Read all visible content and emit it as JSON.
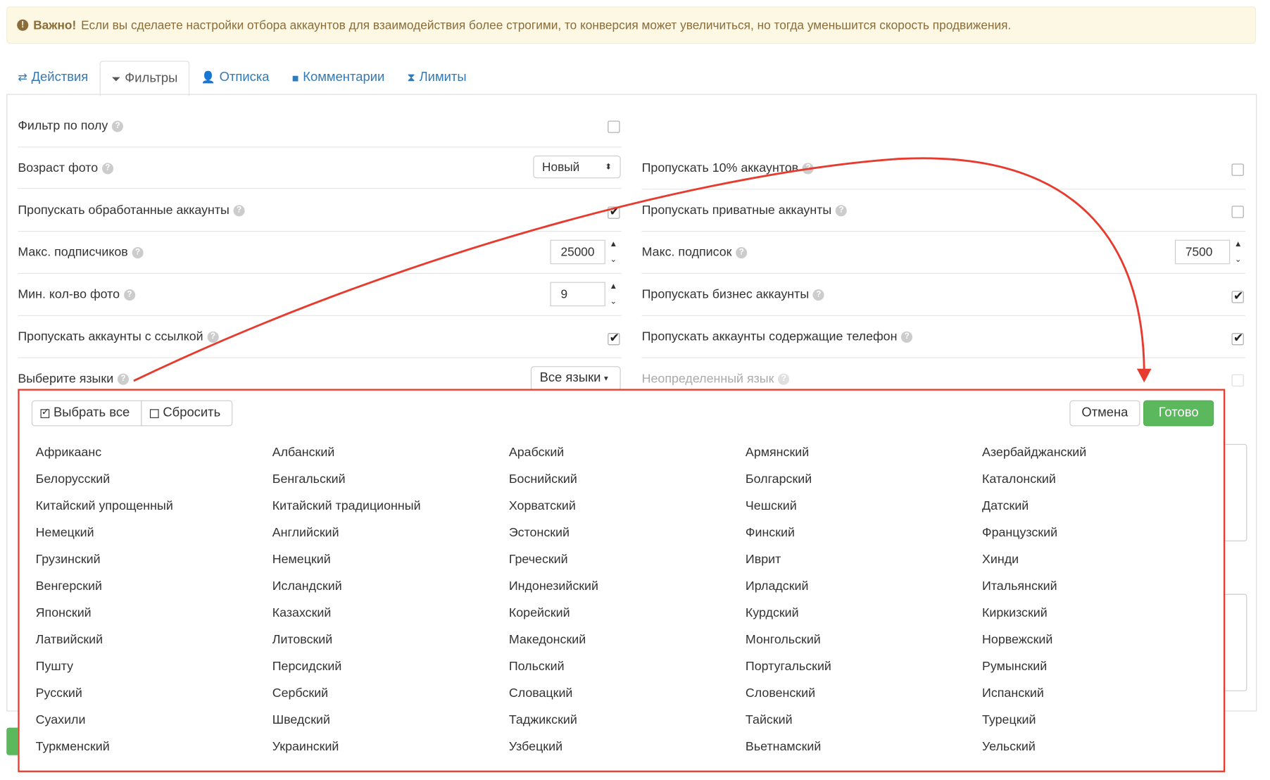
{
  "alert": {
    "strong": "Важно!",
    "text": "Если вы сделаете настройки отбора аккаунтов для взаимодействия более строгими, то конверсия может увеличиться, но тогда уменьшится скорость продвижения."
  },
  "tabs": [
    {
      "label": "Действия",
      "icon": "arrows-icon"
    },
    {
      "label": "Фильтры",
      "icon": "filter-icon"
    },
    {
      "label": "Отписка",
      "icon": "user-remove-icon"
    },
    {
      "label": "Комментарии",
      "icon": "comment-icon"
    },
    {
      "label": "Лимиты",
      "icon": "hourglass-icon"
    }
  ],
  "left": {
    "gender": "Фильтр по полу",
    "photo_age": "Возраст фото",
    "photo_age_value": "Новый",
    "skip_processed": "Пропускать обработанные аккаунты",
    "max_followers": "Макс. подписчиков",
    "max_followers_value": "25000",
    "min_photos": "Мин. кол-во фото",
    "min_photos_value": "9",
    "skip_link": "Пропускать аккаунты с ссылкой",
    "languages": "Выберите языки",
    "languages_value": "Все языки"
  },
  "right": {
    "skip10": "Пропускать 10% аккаунтов",
    "skip_private": "Пропускать приватные аккаунты",
    "max_following": "Макс. подписок",
    "max_following_value": "7500",
    "skip_business": "Пропускать бизнес аккаунты",
    "skip_phone": "Пропускать аккаунты содержащие телефон",
    "undefined_lang": "Неопределенный язык"
  },
  "dropdown": {
    "select_all": "Выбрать все",
    "reset": "Сбросить",
    "cancel": "Отмена",
    "done": "Готово",
    "languages": [
      "Африкаанс",
      "Албанский",
      "Арабский",
      "Армянский",
      "Азербайджанский",
      "Белорусский",
      "Бенгальский",
      "Боснийский",
      "Болгарский",
      "Каталонский",
      "Китайский упрощенный",
      "Китайский традиционный",
      "Хорватский",
      "Чешский",
      "Датский",
      "Немецкий",
      "Английский",
      "Эстонский",
      "Финский",
      "Французский",
      "Грузинский",
      "Немецкий",
      "Греческий",
      "Иврит",
      "Хинди",
      "Венгерский",
      "Исландский",
      "Индонезийский",
      "Ирладский",
      "Итальянский",
      "Японский",
      "Казахский",
      "Корейский",
      "Курдский",
      "Киркизский",
      "Латвийский",
      "Литовский",
      "Македонский",
      "Монгольский",
      "Норвежский",
      "Пушту",
      "Персидский",
      "Польский",
      "Португальский",
      "Румынский",
      "Русский",
      "Сербский",
      "Словацкий",
      "Словенский",
      "Испанский",
      "Суахили",
      "Шведский",
      "Таджикский",
      "Тайский",
      "Турецкий",
      "Туркменский",
      "Украинский",
      "Узбецкий",
      "Вьетнамский",
      "Уельский"
    ]
  },
  "colors": {
    "link": "#337ab7",
    "success": "#5cb85c",
    "annotation": "#e63b2e",
    "alert_bg": "#fcf8e3"
  }
}
